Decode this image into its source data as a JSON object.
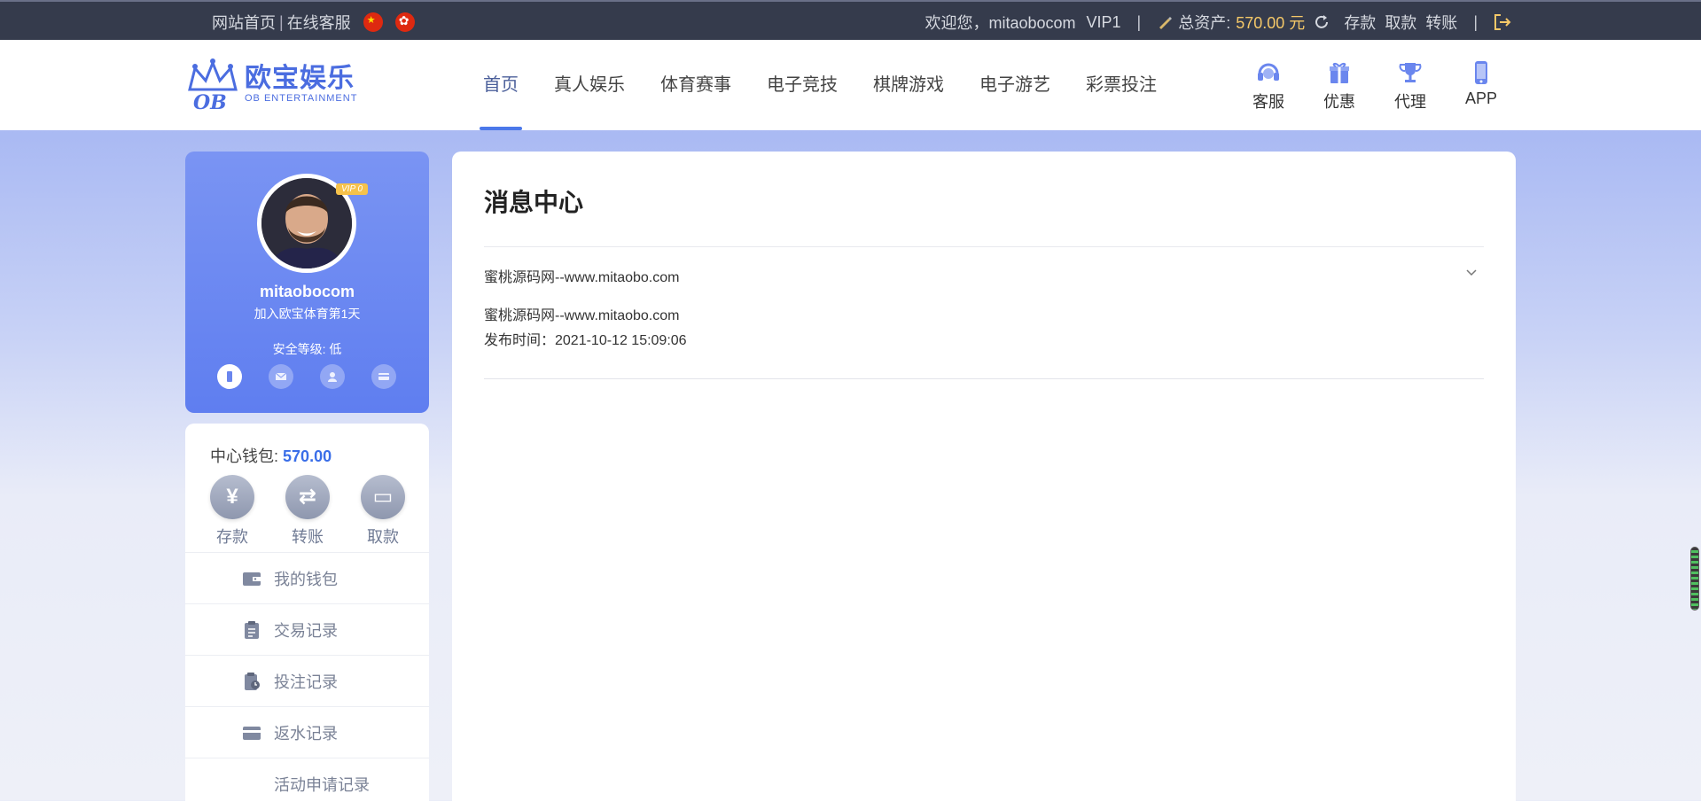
{
  "topbar": {
    "home": "网站首页",
    "separator": "|",
    "service": "在线客服",
    "welcome": "欢迎您，mitaobocom",
    "vip": "VIP1",
    "divider": "|",
    "assets_label": "总资产:",
    "assets_value": "570.00 元",
    "deposit": "存款",
    "withdraw": "取款",
    "transfer": "转账"
  },
  "logo": {
    "cn": "欧宝娱乐",
    "en": "OB ENTERTAINMENT",
    "badge": "OB"
  },
  "nav": {
    "items": [
      {
        "label": "首页"
      },
      {
        "label": "真人娱乐"
      },
      {
        "label": "体育赛事"
      },
      {
        "label": "电子竞技"
      },
      {
        "label": "棋牌游戏"
      },
      {
        "label": "电子游艺"
      },
      {
        "label": "彩票投注"
      }
    ]
  },
  "quick": {
    "items": [
      {
        "label": "客服",
        "icon": "headset-icon"
      },
      {
        "label": "优惠",
        "icon": "gift-icon"
      },
      {
        "label": "代理",
        "icon": "trophy-icon"
      },
      {
        "label": "APP",
        "icon": "phone-icon"
      }
    ]
  },
  "profile": {
    "vip_tag": "VIP 0",
    "username": "mitaobocom",
    "join_text": "加入欧宝体育第1天",
    "safety": "安全等级: 低"
  },
  "wallet": {
    "label": "中心钱包:",
    "value": "570.00",
    "buttons": [
      {
        "label": "存款",
        "glyph": "¥"
      },
      {
        "label": "转账",
        "glyph": "⇄"
      },
      {
        "label": "取款",
        "glyph": "▭"
      }
    ]
  },
  "menu": {
    "items": [
      {
        "label": "我的钱包"
      },
      {
        "label": "交易记录"
      },
      {
        "label": "投注记录"
      },
      {
        "label": "返水记录"
      },
      {
        "label": "活动申请记录"
      }
    ]
  },
  "content": {
    "title": "消息中心",
    "message_title": "蜜桃源码网--www.mitaobo.com",
    "message_body": "蜜桃源码网--www.mitaobo.com",
    "message_time": "发布时间：2021-10-12 15:09:06"
  },
  "colors": {
    "topbar_bg": "#353b4c",
    "accent": "#4b78ea",
    "amount": "#f5c868",
    "profile_bg": "#6a88f2"
  }
}
